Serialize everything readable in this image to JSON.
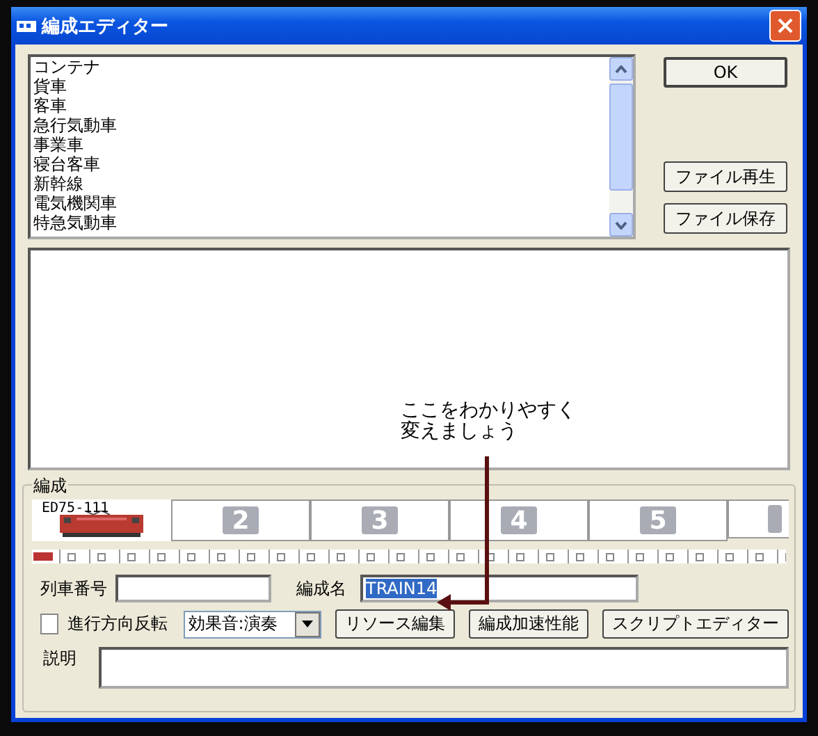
{
  "window": {
    "title": "編成エディター"
  },
  "vehicle_list": {
    "items": [
      "コンテナ",
      "貨車",
      "客車",
      "急行気動車",
      "事業車",
      "寝台客車",
      "新幹線",
      "電気機関車",
      "特急気動車"
    ]
  },
  "side_buttons": [
    "OK",
    "ファイル再生",
    "ファイル保存"
  ],
  "annotation": {
    "lines": [
      "ここをわかりやすく",
      "変えましょう"
    ]
  },
  "formation": {
    "label": "編成",
    "cars": [
      {
        "kind": "loco",
        "label": "ED75-111"
      },
      {
        "kind": "empty",
        "number": "2"
      },
      {
        "kind": "empty",
        "number": "3"
      },
      {
        "kind": "empty",
        "number": "4"
      },
      {
        "kind": "empty",
        "number": "5"
      },
      {
        "kind": "cut"
      }
    ]
  },
  "train_number": {
    "label": "列車番号"
  },
  "formation_name": {
    "label": "編成名",
    "value": "TRAIN14",
    "selected": true
  },
  "reverse": {
    "label": "進行方向反転",
    "checked": false
  },
  "sound_select": {
    "value": "効果音:演奏"
  },
  "action_buttons": [
    "リソース編集",
    "編成加速性能",
    "スクリプトエディター"
  ],
  "description": {
    "label": "説明"
  }
}
